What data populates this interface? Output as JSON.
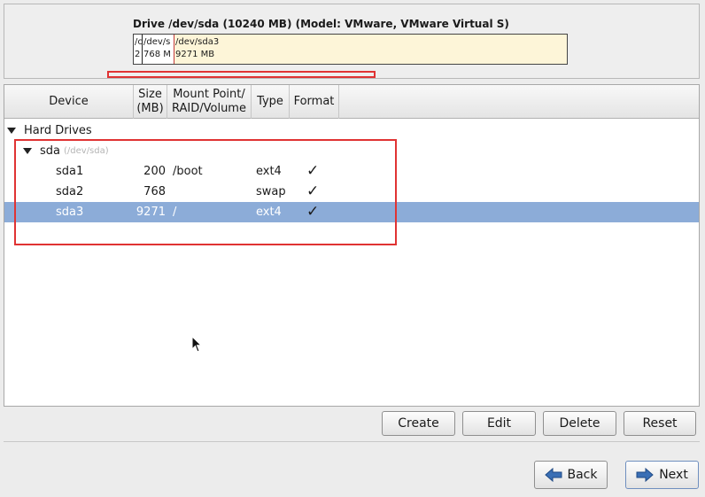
{
  "drive": {
    "title": "Drive /dev/sda (10240 MB) (Model: VMware, VMware Virtual S)",
    "segments": [
      {
        "name": "/c",
        "size": "2"
      },
      {
        "name": "/dev/s",
        "size": "768 M"
      },
      {
        "name": "/dev/sda3",
        "size": "9271 MB"
      }
    ]
  },
  "table": {
    "headers": {
      "device": "Device",
      "size_line1": "Size",
      "size_line2": "(MB)",
      "mount_line1": "Mount Point/",
      "mount_line2": "RAID/Volume",
      "type": "Type",
      "format": "Format"
    },
    "group": "Hard Drives",
    "drive": {
      "name": "sda",
      "path": "(/dev/sda)"
    },
    "partitions": [
      {
        "device": "sda1",
        "size": "200",
        "mount": "/boot",
        "type": "ext4",
        "format": "✓"
      },
      {
        "device": "sda2",
        "size": "768",
        "mount": "",
        "type": "swap",
        "format": "✓"
      },
      {
        "device": "sda3",
        "size": "9271",
        "mount": "/",
        "type": "ext4",
        "format": "✓"
      }
    ]
  },
  "actions": {
    "create": "Create",
    "edit": "Edit",
    "delete": "Delete",
    "reset": "Reset"
  },
  "nav": {
    "back": "Back",
    "next": "Next"
  },
  "colors": {
    "selection": "#8cacd8",
    "highlight": "#e03333",
    "free_space": "#fdf5d8",
    "nav_arrow": "#3a6fb5"
  },
  "icons": {
    "back": "arrow-left-icon",
    "next": "arrow-right-icon",
    "check": "checkmark-icon",
    "expander": "triangle-down-icon"
  }
}
